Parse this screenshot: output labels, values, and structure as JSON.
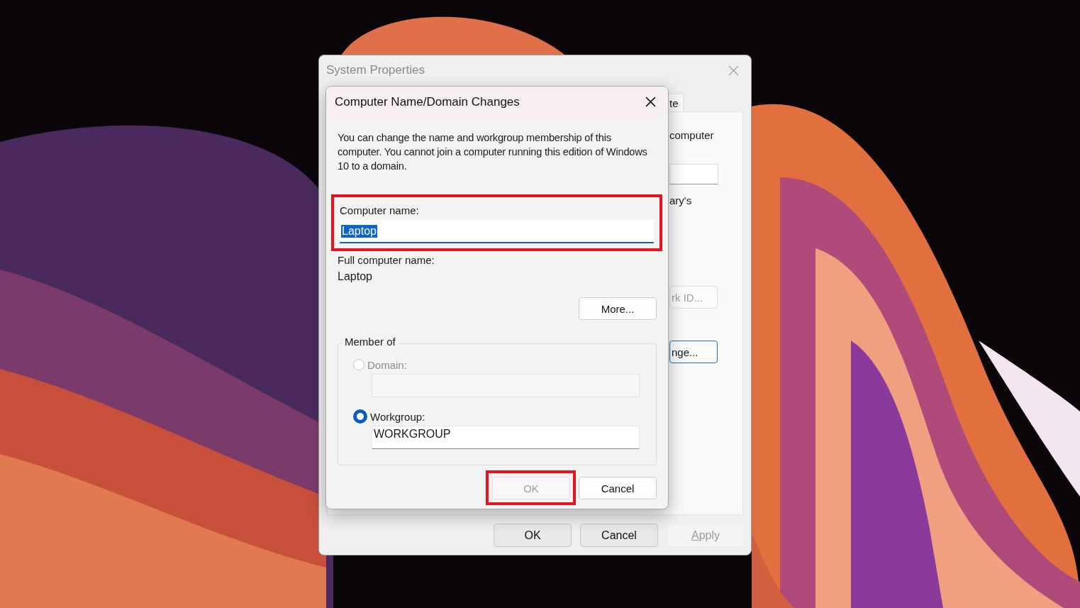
{
  "back_window": {
    "title": "System Properties",
    "tab_fragment": "te",
    "text_fragments": [
      "computer",
      "ary's"
    ],
    "buttons": [
      {
        "label": "rk ID...",
        "disabled": true,
        "focused": false
      },
      {
        "label": "nge...",
        "disabled": false,
        "focused": true
      }
    ],
    "footer_buttons": [
      {
        "label": "OK",
        "disabled": false
      },
      {
        "label": "Cancel",
        "disabled": false
      },
      {
        "label": "Apply",
        "disabled": true
      }
    ]
  },
  "dialog": {
    "title": "Computer Name/Domain Changes",
    "description": "You can change the name and workgroup membership of this computer. You cannot join a computer running this edition of Windows 10 to a domain.",
    "computer_name": {
      "label": "Computer name:",
      "value": "Laptop",
      "highlighted": true
    },
    "full_name_label": "Full computer name:",
    "full_name": "Laptop",
    "more_button": "More...",
    "member_of": {
      "legend": "Member of",
      "options": [
        {
          "label": "Domain:",
          "selected": false,
          "disabled": true
        },
        {
          "label": "Workgroup:",
          "selected": true,
          "disabled": false,
          "value": "WORKGROUP"
        }
      ]
    },
    "buttons": [
      {
        "label": "OK",
        "disabled": true,
        "highlighted": true
      },
      {
        "label": "Cancel",
        "disabled": false,
        "highlighted": false
      }
    ]
  }
}
